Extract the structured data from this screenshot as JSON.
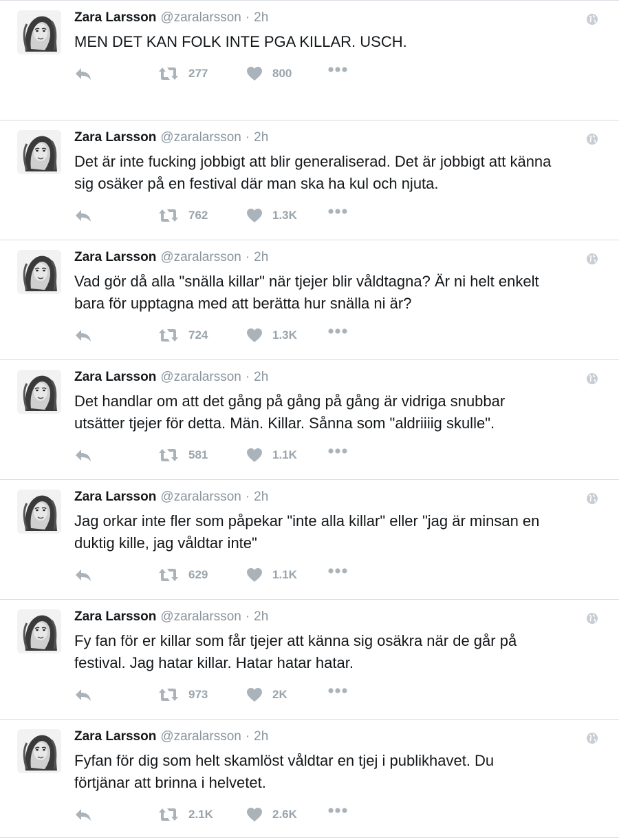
{
  "tweets": [
    {
      "name": "Zara Larsson",
      "handle": "@zaralarsson",
      "separator": "·",
      "time": "2h",
      "text": "MEN DET KAN FOLK INTE PGA KILLAR. USCH.",
      "retweets": "277",
      "likes": "800"
    },
    {
      "name": "Zara Larsson",
      "handle": "@zaralarsson",
      "separator": "·",
      "time": "2h",
      "text": "Det är inte fucking jobbigt att blir generaliserad. Det är jobbigt att känna\nsig osäker på en festival där man ska ha kul och njuta.",
      "retweets": "762",
      "likes": "1.3K"
    },
    {
      "name": "Zara Larsson",
      "handle": "@zaralarsson",
      "separator": "·",
      "time": "2h",
      "text": "Vad gör då alla \"snälla killar\" när tjejer blir våldtagna? Är ni helt enkelt\nbara för upptagna med att berätta hur snälla ni är?",
      "retweets": "724",
      "likes": "1.3K"
    },
    {
      "name": "Zara Larsson",
      "handle": "@zaralarsson",
      "separator": "·",
      "time": "2h",
      "text": "Det handlar om att det gång på gång på gång är vidriga snubbar\nutsätter tjejer för detta. Män. Killar. Sånna som \"aldriiiig skulle\".",
      "retweets": "581",
      "likes": "1.1K"
    },
    {
      "name": "Zara Larsson",
      "handle": "@zaralarsson",
      "separator": "·",
      "time": "2h",
      "text": "Jag orkar inte fler som påpekar \"inte alla killar\" eller \"jag är minsan en\nduktig kille, jag våldtar inte\"",
      "retweets": "629",
      "likes": "1.1K"
    },
    {
      "name": "Zara Larsson",
      "handle": "@zaralarsson",
      "separator": "·",
      "time": "2h",
      "text": "Fy fan för er killar som får tjejer att känna sig osäkra när de går på\nfestival. Jag hatar killar. Hatar hatar hatar.",
      "retweets": "973",
      "likes": "2K"
    },
    {
      "name": "Zara Larsson",
      "handle": "@zaralarsson",
      "separator": "·",
      "time": "2h",
      "text": "Fyfan för dig som helt skamlöst våldtar en tjej i publikhavet. Du\nförtjänar att brinna i helvetet.",
      "retweets": "2.1K",
      "likes": "2.6K"
    }
  ],
  "icons": {
    "reply": "reply-icon",
    "retweet": "retweet-icon",
    "like": "heart-icon",
    "more": "more-icon",
    "globe": "globe-icon",
    "avatar": "avatar"
  },
  "colors": {
    "icon_gray": "#aab3ba",
    "count_gray": "#9aa4ac",
    "meta_gray": "#8a959e",
    "divider": "#d8dde2",
    "text": "#14171a"
  }
}
